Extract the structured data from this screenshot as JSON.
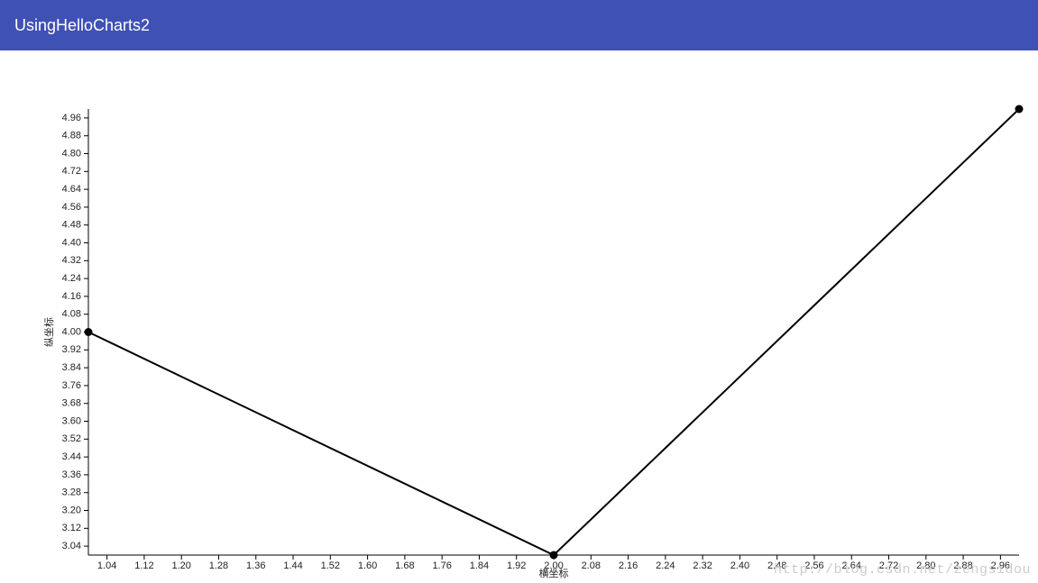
{
  "header": {
    "title": "UsingHelloCharts2"
  },
  "watermark": "http://blog.csdn.net/zengsidou",
  "chart_data": {
    "type": "line",
    "xlabel": "横坐标",
    "ylabel": "纵坐标",
    "x": [
      1.0,
      2.0,
      3.0
    ],
    "y": [
      4.0,
      3.0,
      5.0
    ],
    "xlim": [
      1.0,
      3.0
    ],
    "ylim": [
      3.0,
      5.0
    ],
    "x_ticks": [
      1.04,
      1.12,
      1.2,
      1.28,
      1.36,
      1.44,
      1.52,
      1.6,
      1.68,
      1.76,
      1.84,
      1.92,
      2.0,
      2.08,
      2.16,
      2.24,
      2.32,
      2.4,
      2.48,
      2.56,
      2.64,
      2.72,
      2.8,
      2.88,
      2.96
    ],
    "y_ticks": [
      3.04,
      3.12,
      3.2,
      3.28,
      3.36,
      3.44,
      3.52,
      3.6,
      3.68,
      3.76,
      3.84,
      3.92,
      4.0,
      4.08,
      4.16,
      4.24,
      4.32,
      4.4,
      4.48,
      4.56,
      4.64,
      4.72,
      4.8,
      4.88,
      4.96
    ]
  }
}
